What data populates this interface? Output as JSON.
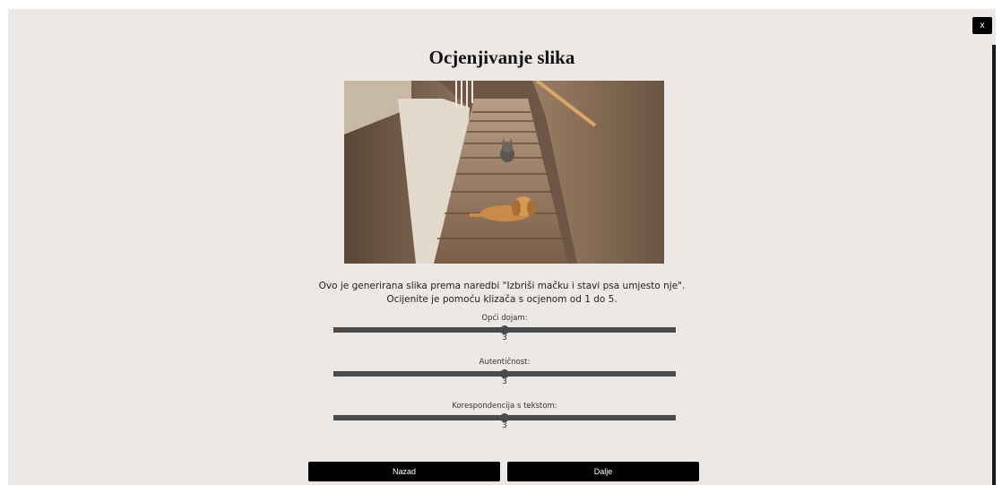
{
  "dialog": {
    "close_label": "x",
    "title": "Ocjenjivanje slika"
  },
  "image": {
    "icon": "generated-image-stairs-dog-cat"
  },
  "description": {
    "line1": "Ovo je generirana slika prema naredbi \"Izbriši mačku i stavi psa umjesto nje\".",
    "line2": "Ocijenite je pomoću klizača s ocjenom od 1 do 5."
  },
  "sliders": [
    {
      "label": "Opći dojam:",
      "value": "3",
      "min": 1,
      "max": 5
    },
    {
      "label": "Autentičnost:",
      "value": "3",
      "min": 1,
      "max": 5
    },
    {
      "label": "Korespondencija s tekstom:",
      "value": "3",
      "min": 1,
      "max": 5
    }
  ],
  "buttons": {
    "back": "Nazad",
    "next": "Dalje"
  },
  "colors": {
    "background": "#ece8e6",
    "button": "#000000",
    "slider": "#4a4a4a"
  }
}
